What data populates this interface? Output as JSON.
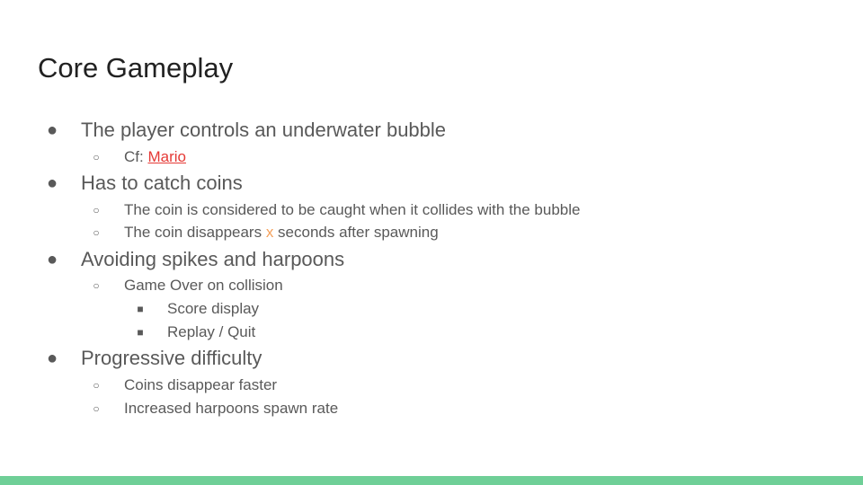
{
  "slide": {
    "title": "Core Gameplay",
    "bullets": {
      "b1": {
        "text": "The player controls an underwater bubble",
        "sub1_prefix": "Cf: ",
        "sub1_link": "Mario"
      },
      "b2": {
        "text": "Has to catch coins",
        "sub1": "The coin is considered to be caught when it collides with the bubble",
        "sub2_before": "The coin disappears ",
        "sub2_var": "x",
        "sub2_after": " seconds after spawning"
      },
      "b3": {
        "text": "Avoiding spikes and harpoons",
        "sub1": "Game Over on collision",
        "sub1_sub1": "Score display",
        "sub1_sub2": "Replay / Quit"
      },
      "b4": {
        "text": "Progressive difficulty",
        "sub1": "Coins disappear faster",
        "sub2": "Increased harpoons spawn rate"
      }
    },
    "bullet_glyphs": {
      "level1": "●",
      "level2": "○",
      "level3": "■"
    },
    "colors": {
      "accent_bar": "#6fcf97",
      "link": "#e53935",
      "variable": "#f5a25d"
    }
  }
}
